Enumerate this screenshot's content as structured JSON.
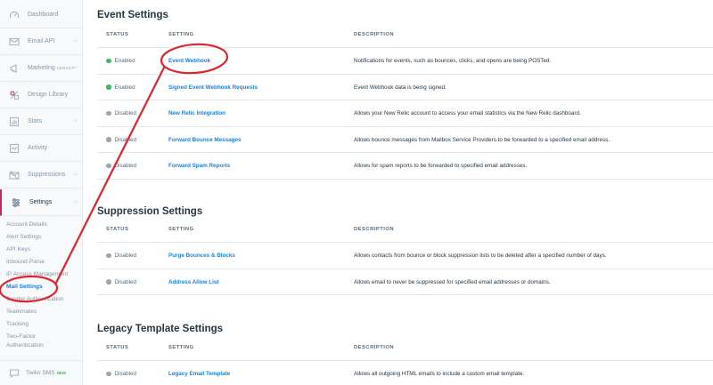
{
  "sidebar": {
    "nav": [
      {
        "label": "Dashboard",
        "icon": "dashboard-icon"
      },
      {
        "label": "Email API",
        "icon": "email-api-icon",
        "chevron": true
      },
      {
        "label": "Marketing",
        "tag": "LEGACY",
        "icon": "marketing-icon",
        "chevron": true
      },
      {
        "label": "Design Library",
        "icon": "design-library-icon"
      },
      {
        "label": "Stats",
        "icon": "stats-icon",
        "chevron": true
      },
      {
        "label": "Activity",
        "icon": "activity-icon"
      },
      {
        "label": "Suppressions",
        "icon": "suppressions-icon",
        "chevron": true
      },
      {
        "label": "Settings",
        "icon": "settings-icon",
        "chevron": true
      }
    ],
    "settings_sub": [
      "Account Details",
      "Alert Settings",
      "API Keys",
      "Inbound Parse",
      "IP Access Management",
      "Mail Settings",
      "Sender Authentication",
      "Teammates",
      "Tracking",
      "Two-Factor",
      "Authentication"
    ],
    "twilio": {
      "label": "Twilio SMS",
      "badge": "NEW"
    }
  },
  "columns": {
    "status": "STATUS",
    "setting": "SETTING",
    "description": "DESCRIPTION"
  },
  "sections": [
    {
      "title": "Event Settings",
      "rows": [
        {
          "status": "Enabled",
          "setting": "Event Webhook",
          "description": "Notifications for events, such as bounces, clicks, and opens are being POSTed."
        },
        {
          "status": "Enabled",
          "setting": "Signed Event Webhook Requests",
          "description": "Event Webhook data is being signed."
        },
        {
          "status": "Disabled",
          "setting": "New Relic Integration",
          "description": "Allows your New Relic account to access your email statistics via the New Relic dashboard."
        },
        {
          "status": "Disabled",
          "setting": "Forward Bounce Messages",
          "description": "Allows bounce messages from Mailbox Service Providers to be forwarded to a specified email address."
        },
        {
          "status": "Disabled",
          "setting": "Forward Spam Reports",
          "description": "Allows for spam reports to be forwarded to specified email addresses."
        }
      ]
    },
    {
      "title": "Suppression Settings",
      "rows": [
        {
          "status": "Disabled",
          "setting": "Purge Bounces & Blocks",
          "description": "Allows contacts from bounce or block suppression lists to be deleted after a specified number of days."
        },
        {
          "status": "Disabled",
          "setting": "Address Allow List",
          "description": "Allows email to never be suppressed for specified email addresses or domains."
        }
      ]
    },
    {
      "title": "Legacy Template Settings",
      "rows": [
        {
          "status": "Disabled",
          "setting": "Legacy Email Template",
          "description": "Allows all outgoing HTML emails to include a custom email template."
        }
      ]
    }
  ],
  "colors": {
    "enabled": "#3dbb63",
    "disabled": "#9aa5b0",
    "link": "#1a82e2",
    "annotation": "#e0242d"
  }
}
